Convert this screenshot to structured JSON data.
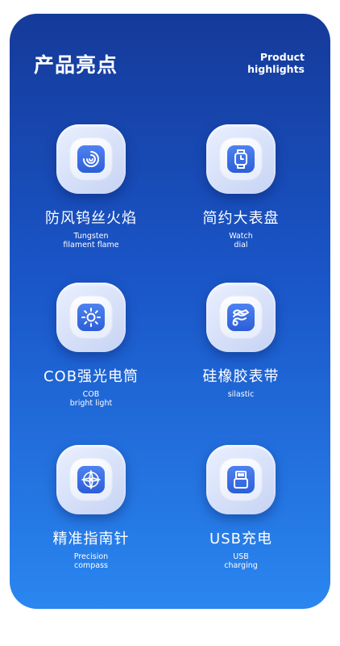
{
  "header": {
    "title": "产品亮点",
    "subtitle_line1": "Product",
    "subtitle_line2": "highlights"
  },
  "features": [
    {
      "cn": "防风钨丝火焰",
      "en1": "Tungsten",
      "en2": "filament flame",
      "icon": "swirl-flame-icon"
    },
    {
      "cn": "简约大表盘",
      "en1": "Watch",
      "en2": "dial",
      "icon": "watch-icon"
    },
    {
      "cn": "COB强光电筒",
      "en1": "COB",
      "en2": "bright light",
      "icon": "sun-light-icon"
    },
    {
      "cn": "硅橡胶表带",
      "en1": "silastic",
      "en2": "",
      "icon": "strap-roll-icon"
    },
    {
      "cn": "精准指南针",
      "en1": "Precision",
      "en2": "compass",
      "icon": "compass-icon"
    },
    {
      "cn": "USB充电",
      "en1": "USB",
      "en2": "charging",
      "icon": "usb-icon"
    }
  ],
  "colors": {
    "gradient_top": "#153a9a",
    "gradient_bottom": "#2a86f0",
    "icon_accent": "#2c5fd8"
  }
}
